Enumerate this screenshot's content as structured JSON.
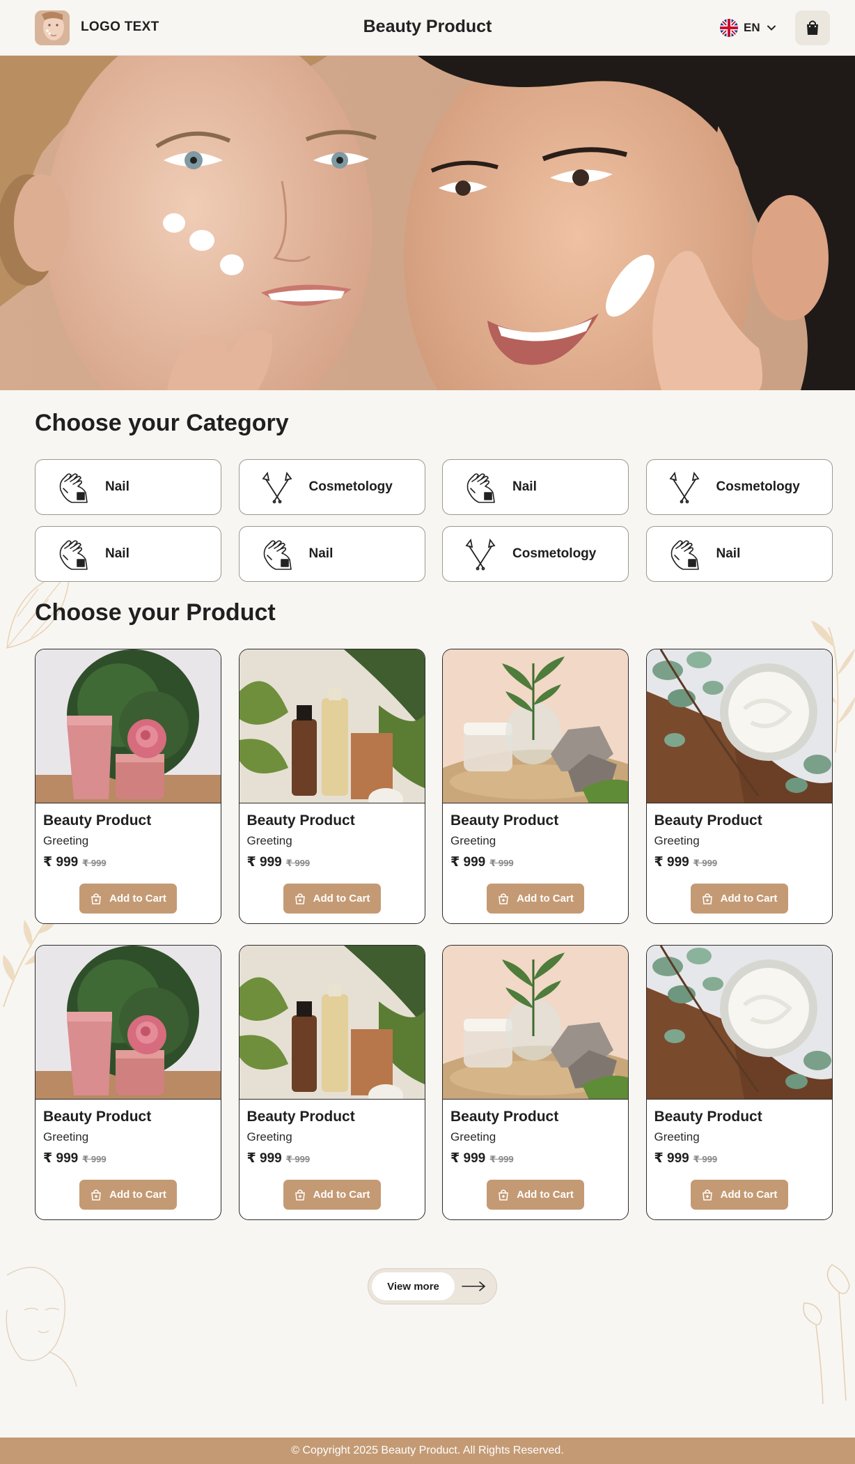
{
  "header": {
    "logo_text": "LOGO TEXT",
    "title": "Beauty Product",
    "language": "EN"
  },
  "categories_section": {
    "title": "Choose your Category",
    "items": [
      {
        "label": "Nail",
        "icon": "nail-hand-icon"
      },
      {
        "label": "Cosmetology",
        "icon": "cosmetology-tools-icon"
      },
      {
        "label": "Nail",
        "icon": "nail-hand-icon"
      },
      {
        "label": "Cosmetology",
        "icon": "cosmetology-tools-icon"
      },
      {
        "label": "Nail",
        "icon": "nail-hand-icon"
      },
      {
        "label": "Nail",
        "icon": "nail-hand-icon"
      },
      {
        "label": "Cosmetology",
        "icon": "cosmetology-tools-icon"
      },
      {
        "label": "Nail",
        "icon": "nail-hand-icon"
      }
    ]
  },
  "products_section": {
    "title": "Choose your Product",
    "items": [
      {
        "name": "Beauty Product",
        "subtitle": "Greeting",
        "price": "₹ 999",
        "old_price": "₹ 999",
        "button": "Add to Cart",
        "image": "pink-tube-rose"
      },
      {
        "name": "Beauty Product",
        "subtitle": "Greeting",
        "price": "₹ 999",
        "old_price": "₹ 999",
        "button": "Add to Cart",
        "image": "bottles-plants"
      },
      {
        "name": "Beauty Product",
        "subtitle": "Greeting",
        "price": "₹ 999",
        "old_price": "₹ 999",
        "button": "Add to Cart",
        "image": "jar-sand-stones"
      },
      {
        "name": "Beauty Product",
        "subtitle": "Greeting",
        "price": "₹ 999",
        "old_price": "₹ 999",
        "button": "Add to Cart",
        "image": "cream-jar-leaves"
      },
      {
        "name": "Beauty Product",
        "subtitle": "Greeting",
        "price": "₹ 999",
        "old_price": "₹ 999",
        "button": "Add to Cart",
        "image": "pink-tube-rose"
      },
      {
        "name": "Beauty Product",
        "subtitle": "Greeting",
        "price": "₹ 999",
        "old_price": "₹ 999",
        "button": "Add to Cart",
        "image": "bottles-plants"
      },
      {
        "name": "Beauty Product",
        "subtitle": "Greeting",
        "price": "₹ 999",
        "old_price": "₹ 999",
        "button": "Add to Cart",
        "image": "jar-sand-stones"
      },
      {
        "name": "Beauty Product",
        "subtitle": "Greeting",
        "price": "₹ 999",
        "old_price": "₹ 999",
        "button": "Add to Cart",
        "image": "cream-jar-leaves"
      }
    ],
    "view_more": "View more"
  },
  "footer": {
    "copyright": "© Copyright 2025 Beauty Product. All Rights Reserved."
  },
  "colors": {
    "background": "#f8f6f2",
    "accent": "#c49a74",
    "text": "#1f1f1f"
  }
}
